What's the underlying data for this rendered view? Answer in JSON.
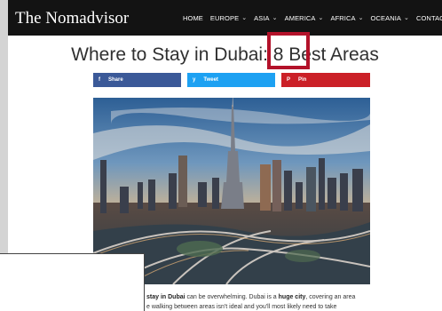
{
  "header": {
    "brand": "The Nomadvisor",
    "nav": [
      {
        "label": "HOME",
        "dropdown": false
      },
      {
        "label": "EUROPE",
        "dropdown": true
      },
      {
        "label": "ASIA",
        "dropdown": true
      },
      {
        "label": "AMERICA",
        "dropdown": true
      },
      {
        "label": "AFRICA",
        "dropdown": true
      },
      {
        "label": "OCEANIA",
        "dropdown": true
      },
      {
        "label": "CONTACT",
        "dropdown": false
      }
    ],
    "chevron_glyph": "⌄"
  },
  "article": {
    "title": "Where to Stay in Dubai: 8 Best Areas",
    "highlighted_word": "Best"
  },
  "share": {
    "facebook": {
      "icon": "f",
      "label": "Share",
      "color": "#3b5998"
    },
    "twitter": {
      "icon": "y",
      "label": "Tweet",
      "color": "#1da1f2"
    },
    "pinterest": {
      "icon": "P",
      "label": "Pin",
      "color": "#cb2027"
    }
  },
  "intro": {
    "part1": "stay in Dubai",
    "part2": " can be overwhelming. Dubai is a ",
    "part3": "huge city",
    "part4": ", covering an area",
    "line2": "e walking between areas isn't ideal and you'll most likely need to take"
  },
  "colors": {
    "navbar": "#131313",
    "highlight": "#b3122a"
  }
}
